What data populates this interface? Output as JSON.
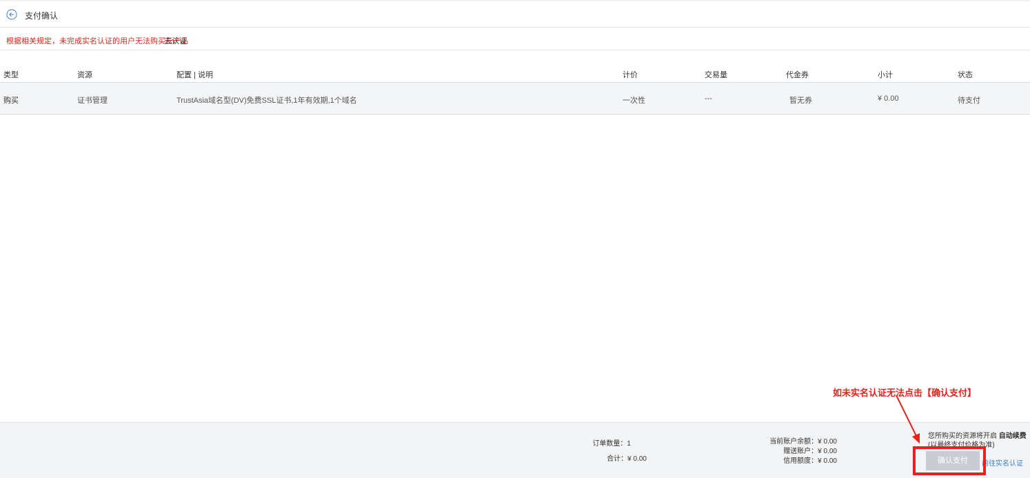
{
  "header": {
    "title": "支付确认"
  },
  "notice": {
    "text": "根据相关规定，未完成实名认证的用户无法购买云产品",
    "link": "去认证"
  },
  "table": {
    "columns": [
      "类型",
      "资源",
      "配置 | 说明",
      "计价",
      "交易量",
      "代金券",
      "小计",
      "状态"
    ],
    "rows": [
      [
        "购买",
        "证书管理",
        "TrustAsia域名型(DV)免费SSL证书,1年有效期,1个域名",
        "一次性",
        "---",
        "暂无券",
        "¥ 0.00",
        "待支付"
      ]
    ]
  },
  "footer": {
    "order_count": "订单数量：1",
    "total": "合计：¥ 0.00",
    "balance": "当前账户余额：¥ 0.00",
    "gift_account": "赠送账户：¥ 0.00",
    "credit": "信用额度：¥ 0.00",
    "renew_prefix": "您所购买的资源将开启",
    "renew_bold": "自动续费",
    "renew_note": "(以最终支付价格为准)",
    "pay_button": "确认支付",
    "verify_link": "前往实名认证"
  },
  "annotation": {
    "text": "如未实名认证无法点击【确认支付】",
    "color": "#e8211c"
  },
  "colors": {
    "warning": "#e1251b",
    "link": "#3a7bd5",
    "button_disabled": "#c9cdd3"
  },
  "icons": {
    "back": "arrow-left-circle-icon"
  }
}
